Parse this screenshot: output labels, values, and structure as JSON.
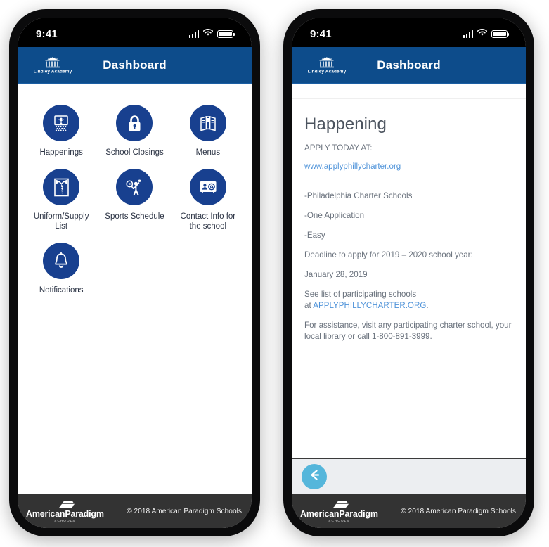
{
  "status_bar": {
    "time": "9:41",
    "signal_icon": "cellular-signal-icon",
    "wifi_icon": "wifi-icon",
    "battery_icon": "battery-full-icon"
  },
  "header": {
    "title": "Dashboard",
    "logo_name": "Lindley Academy",
    "logo_icon": "school-building-icon",
    "background_color": "#0d4c8b"
  },
  "dashboard": {
    "accent_circle_color": "#18408f",
    "tiles": [
      {
        "label": "Happenings",
        "icon": "happenings-stage-icon"
      },
      {
        "label": "School Closings",
        "icon": "lock-icon"
      },
      {
        "label": "Menus",
        "icon": "open-menu-book-icon"
      },
      {
        "label": "Uniform/Supply List",
        "icon": "shirt-tie-icon"
      },
      {
        "label": "Sports Schedule",
        "icon": "tennis-player-icon"
      },
      {
        "label": "Contact Info for the school",
        "icon": "contact-card-icon"
      },
      {
        "label": "Notifications",
        "icon": "bell-icon"
      }
    ]
  },
  "article": {
    "title": "Happening",
    "apply_line": "APPLY TODAY AT:",
    "url_text": "www.applyphillycharter.org",
    "bullets": [
      "-Philadelphia Charter Schools",
      "-One Application",
      "-Easy"
    ],
    "deadline_label": "Deadline to apply for 2019 – 2020 school year:",
    "deadline_date": "January 28, 2019",
    "see_list_prefix": "See list of participating schools",
    "see_list_at": "at ",
    "see_list_link": "APPLYPHILLYCHARTER.ORG",
    "see_list_suffix": ".",
    "assistance": "For assistance, visit any participating charter school, your local library or call 1-800-891-3999.",
    "link_color": "#4f93d9"
  },
  "back_bar": {
    "back_icon": "arrow-left-icon",
    "button_color": "#55b6db"
  },
  "footer": {
    "brand": "AmericanParadigm",
    "brand_sub": "SCHOOLS",
    "logo_icon": "american-paradigm-book-icon",
    "copyright": "© 2018 American Paradigm Schools",
    "background_color": "#333333"
  }
}
